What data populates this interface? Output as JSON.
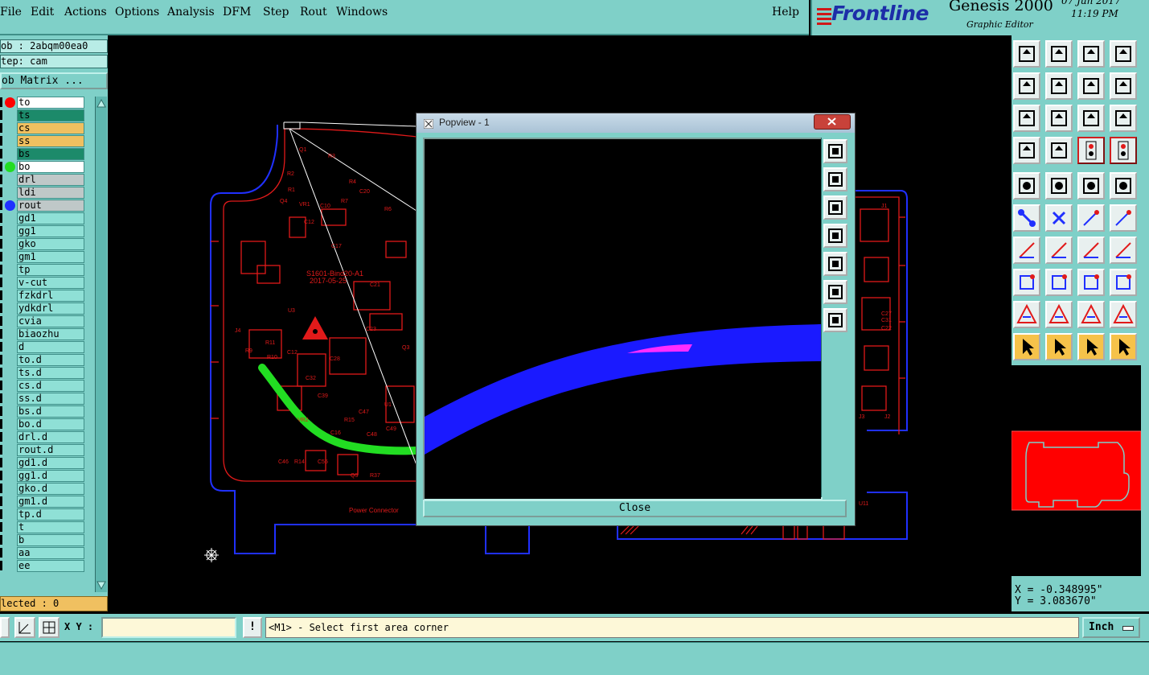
{
  "menu": {
    "items": [
      "File",
      "Edit",
      "Actions",
      "Options",
      "Analysis",
      "DFM",
      "Step",
      "Rout",
      "Windows"
    ],
    "help": "Help"
  },
  "brand": {
    "logo": "Frontline",
    "product": "Genesis 2000",
    "subtitle": "Graphic Editor",
    "date": "07 Jun 2017",
    "time": "11:19 PM"
  },
  "job": {
    "job_label": "ob : 2abqm00ea0",
    "step_label": "tep: cam",
    "matrix_button": "ob Matrix ..."
  },
  "layers": [
    {
      "name": "to",
      "bg": "#ffffff",
      "dot": "#ff0000",
      "tag": "✎▦"
    },
    {
      "name": "ts",
      "bg": "#1c8a6a",
      "dot": "",
      "tag": "✎"
    },
    {
      "name": "cs",
      "bg": "#f0c060",
      "dot": "",
      "tag": "✎"
    },
    {
      "name": "ss",
      "bg": "#f0c060",
      "dot": "",
      "tag": "✎"
    },
    {
      "name": "bs",
      "bg": "#1c8a6a",
      "dot": "",
      "tag": ""
    },
    {
      "name": "bo",
      "bg": "#ffffff",
      "dot": "#22dd22",
      "tag": ""
    },
    {
      "name": "drl",
      "bg": "#bfc8c8",
      "dot": "",
      "tag": ""
    },
    {
      "name": "ldi",
      "bg": "#bfc8c8",
      "dot": "",
      "tag": ""
    },
    {
      "name": "rout",
      "bg": "#bfc8c8",
      "dot": "#2030ff",
      "tag": ""
    },
    {
      "name": "gd1",
      "bg": "#8fe0d6",
      "dot": "",
      "tag": "✎"
    },
    {
      "name": "gg1",
      "bg": "#8fe0d6",
      "dot": "",
      "tag": ""
    },
    {
      "name": "gko",
      "bg": "#8fe0d6",
      "dot": "",
      "tag": ""
    },
    {
      "name": "gm1",
      "bg": "#8fe0d6",
      "dot": "",
      "tag": ""
    },
    {
      "name": "tp",
      "bg": "#8fe0d6",
      "dot": "",
      "tag": ""
    },
    {
      "name": "v-cut",
      "bg": "#8fe0d6",
      "dot": "",
      "tag": ""
    },
    {
      "name": "fzkdrl",
      "bg": "#8fe0d6",
      "dot": "",
      "tag": ""
    },
    {
      "name": "ydkdrl",
      "bg": "#8fe0d6",
      "dot": "",
      "tag": ""
    },
    {
      "name": "cvia",
      "bg": "#8fe0d6",
      "dot": "",
      "tag": ""
    },
    {
      "name": "biaozhu",
      "bg": "#8fe0d6",
      "dot": "",
      "tag": ""
    },
    {
      "name": "d",
      "bg": "#8fe0d6",
      "dot": "",
      "tag": ""
    },
    {
      "name": "to.d",
      "bg": "#8fe0d6",
      "dot": "",
      "tag": "✎"
    },
    {
      "name": "ts.d",
      "bg": "#8fe0d6",
      "dot": "",
      "tag": "✎"
    },
    {
      "name": "cs.d",
      "bg": "#8fe0d6",
      "dot": "",
      "tag": "✎"
    },
    {
      "name": "ss.d",
      "bg": "#8fe0d6",
      "dot": "",
      "tag": "✎"
    },
    {
      "name": "bs.d",
      "bg": "#8fe0d6",
      "dot": "",
      "tag": ""
    },
    {
      "name": "bo.d",
      "bg": "#8fe0d6",
      "dot": "",
      "tag": ""
    },
    {
      "name": "drl.d",
      "bg": "#8fe0d6",
      "dot": "",
      "tag": ""
    },
    {
      "name": "rout.d",
      "bg": "#8fe0d6",
      "dot": "",
      "tag": ""
    },
    {
      "name": "gd1.d",
      "bg": "#8fe0d6",
      "dot": "",
      "tag": "✎"
    },
    {
      "name": "gg1.d",
      "bg": "#8fe0d6",
      "dot": "",
      "tag": ""
    },
    {
      "name": "gko.d",
      "bg": "#8fe0d6",
      "dot": "",
      "tag": ""
    },
    {
      "name": "gm1.d",
      "bg": "#8fe0d6",
      "dot": "",
      "tag": ""
    },
    {
      "name": "tp.d",
      "bg": "#8fe0d6",
      "dot": "",
      "tag": ""
    },
    {
      "name": "t",
      "bg": "#8fe0d6",
      "dot": "",
      "tag": ""
    },
    {
      "name": "b",
      "bg": "#8fe0d6",
      "dot": "",
      "tag": ""
    },
    {
      "name": "aa",
      "bg": "#8fe0d6",
      "dot": "",
      "tag": ""
    },
    {
      "name": "ee",
      "bg": "#8fe0d6",
      "dot": "",
      "tag": ""
    }
  ],
  "selected": "lected : 0",
  "pcb": {
    "board_text_1": "S1601-Bind20-A1",
    "board_text_2": "2017-05-25",
    "power_label": "Power Connector",
    "refs": [
      "Q1",
      "R3",
      "R2",
      "R1",
      "Q4",
      "VR1",
      "C10",
      "R7",
      "R4",
      "C20",
      "C12",
      "R6",
      "C17",
      "U3",
      "J4",
      "R9",
      "R10",
      "C12",
      "R11",
      "C28",
      "C23",
      "Q3",
      "C32",
      "C39",
      "U1",
      "VR2",
      "C16",
      "R15",
      "C47",
      "C48",
      "C49",
      "C46",
      "R14",
      "C55",
      "Q5",
      "R37",
      "C21",
      "J1",
      "J2",
      "U11",
      "C27",
      "C31",
      "C22",
      "J3"
    ]
  },
  "popup": {
    "title": "Popview - 1",
    "close_button": "Close"
  },
  "coords": {
    "x": "X = -0.348995\"",
    "y": "Y = 3.083670\""
  },
  "bottom": {
    "xy_label": "X Y :",
    "xy_value": "",
    "message": "<M1> - Select first area corner",
    "units": "Inch"
  },
  "colors": {
    "panel": "#7fd0c8",
    "pcb_red": "#e11a1a",
    "profile_blue": "#2030ff",
    "trace_green": "#22dd22",
    "popup_blue": "#1a1aff"
  },
  "icons": {
    "toolbar": [
      "layer-up-icon",
      "layer-down-icon",
      "home-icon",
      "window-icon",
      "move-left-icon",
      "move-right-icon",
      "undo-icon",
      "redraw-icon",
      "zoom-fit-icon",
      "zoom-center-icon",
      "ratio-icon",
      "help-icon",
      "measure-icon",
      "probe-icon",
      "snap-icon",
      "net-icon",
      "select-point-icon",
      "select-area-icon",
      "ruler-icon",
      "pad-icon",
      "connect-icon",
      "cross-icon",
      "arrow-point-icon",
      "arrow-point-red-icon",
      "line-up-icon",
      "line-diag-icon",
      "arc-icon",
      "mirror-icon",
      "feature-icon",
      "line-icon",
      "box-icon",
      "fill-icon",
      "triangle-icon",
      "triangle-up-icon",
      "triangle-a-icon",
      "triangle-b-icon",
      "cursor-icon",
      "cursor-red-icon",
      "cursor-circle-icon",
      "net-cursor-icon"
    ],
    "popup_side": [
      "zoom-box-icon",
      "pan-up-icon",
      "pan-down-icon",
      "pan-left-icon",
      "pan-right-icon",
      "zoom-in-icon",
      "zoom-out-icon"
    ]
  }
}
